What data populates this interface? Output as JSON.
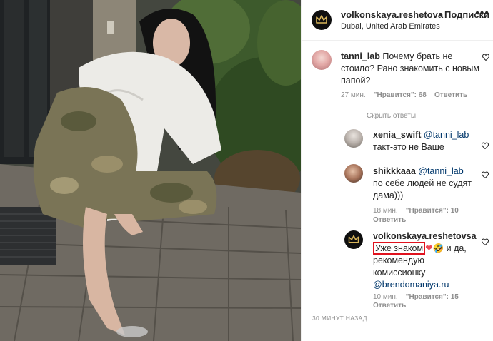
{
  "post": {
    "username": "volkonskaya.reshetova",
    "separator": "•",
    "follow_label": "Подписки",
    "location": "Dubai, United Arab Emirates",
    "more_icon": "more-icon",
    "time_ago": "30 МИНУТ НАЗАД"
  },
  "comments": [
    {
      "username": "tanni_lab",
      "text": "Почему брать не стоило? Рано знакомить с новым папой?",
      "time": "27 мин.",
      "likes": "\"Нравится\": 68",
      "reply_label": "Ответить",
      "avatar_icon": "user-avatar"
    }
  ],
  "hide_replies_label": "Скрыть ответы",
  "replies": [
    {
      "username": "xenia_swift",
      "mention": "@tanni_lab",
      "text": "такт-это не Ваше"
    },
    {
      "username": "shikkkaaa",
      "mention": "@tanni_lab",
      "text_after_mention": "по себе людей не судят дама)))",
      "time": "18 мин.",
      "likes": "\"Нравится\": 10",
      "reply_label": "Ответить"
    },
    {
      "username": "volkonskaya.reshetovsa",
      "highlighted_text": "Уже знаком",
      "emoji": [
        "❤",
        "🤣"
      ],
      "text_after": "и да, рекомендую комиссионку",
      "mention": "@brendomaniya.ru",
      "time": "10 мин.",
      "likes": "\"Нравится\": 15",
      "reply_label": "Ответить"
    }
  ],
  "colors": {
    "text": "#262626",
    "muted": "#8e8e8e",
    "mention": "#00376b",
    "highlight_border": "#e0121e",
    "heart_red": "#ed4956",
    "crown_gold": "#d8b55a"
  }
}
